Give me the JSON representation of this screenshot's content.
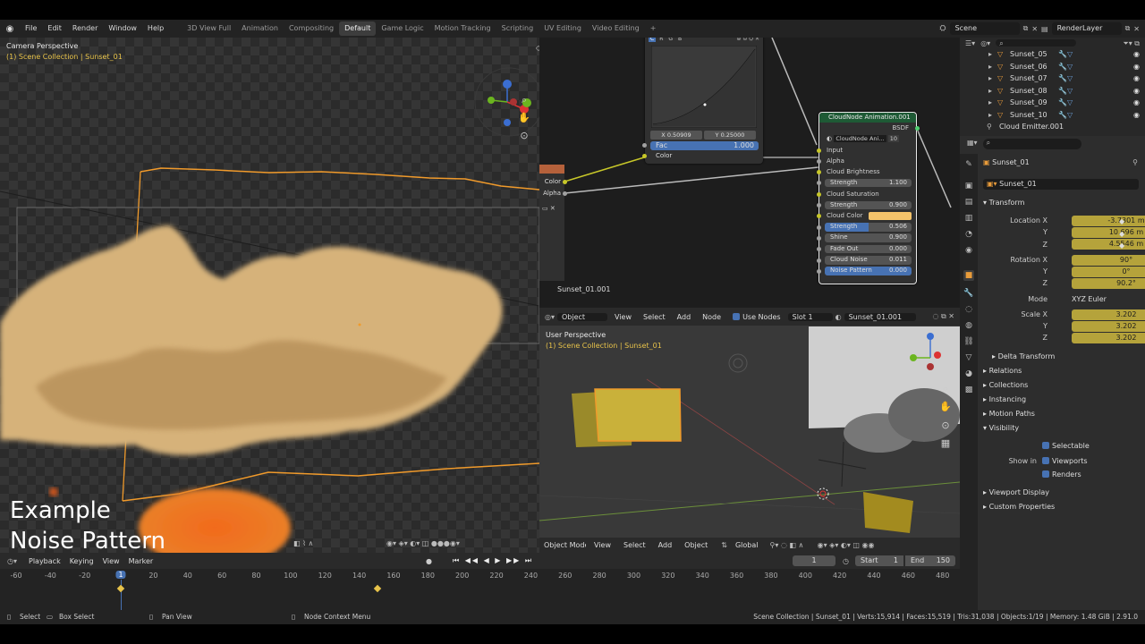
{
  "menu": {
    "file": "File",
    "edit": "Edit",
    "render": "Render",
    "window": "Window",
    "help": "Help"
  },
  "workspaces": [
    "3D View Full",
    "Animation",
    "Compositing",
    "Default",
    "Game Logic",
    "Motion Tracking",
    "Scripting",
    "UV Editing",
    "Video Editing"
  ],
  "active_workspace": "Default",
  "scene_name": "Scene",
  "render_layer": "RenderLayer",
  "camera_view": {
    "title": "Camera Perspective",
    "subtitle": "(1) Scene Collection | Sunset_01"
  },
  "caption": {
    "line1": "Example",
    "line2": "Noise Pattern"
  },
  "curve_node": {
    "tabs": [
      "C",
      "R",
      "G",
      "B"
    ],
    "x_readout": "X 0.50909",
    "y_readout": "Y 0.25000",
    "fac_label": "Fac",
    "fac_value": "1.000",
    "color_label": "Color"
  },
  "left_sockets": {
    "color": "Color",
    "alpha": "Alpha"
  },
  "cloud_node": {
    "title": "CloudNode Animation.001",
    "output": "BSDF",
    "group_field": "CloudNode Ani...",
    "users": "10",
    "rows": {
      "input": "Input",
      "alpha": "Alpha",
      "cloud_brightness": "Cloud Brightness",
      "strength1_label": "Strength",
      "strength1_value": "1.100",
      "cloud_saturation": "Cloud Saturation",
      "strength2_label": "Strength",
      "strength2_value": "0.900",
      "cloud_color": "Cloud Color",
      "strength3_label": "Strength",
      "strength3_value": "0.506",
      "strength3_fraction": 0.506,
      "shine_label": "Shine",
      "shine_value": "0.900",
      "fade_out_label": "Fade Out",
      "fade_out_value": "0.000",
      "cloud_noise_label": "Cloud Noise",
      "cloud_noise_value": "0.011",
      "noise_pattern_label": "Noise Pattern",
      "noise_pattern_value": "0.000"
    },
    "cloud_color_hex": "#f5c36b"
  },
  "node_editor_label": "Sunset_01.001",
  "node_header": {
    "mode": "Object",
    "view": "View",
    "select": "Select",
    "add": "Add",
    "node": "Node",
    "use_nodes": "Use Nodes",
    "slot": "Slot 1",
    "material": "Sunset_01.001"
  },
  "viewport3d": {
    "title": "User Perspective",
    "subtitle": "(1) Scene Collection | Sunset_01"
  },
  "v3_header": {
    "mode": "Object Mode",
    "view": "View",
    "select": "Select",
    "add": "Add",
    "object": "Object",
    "orientation": "Global"
  },
  "timeline": {
    "playback": "Playback",
    "keying": "Keying",
    "view": "View",
    "marker": "Marker",
    "current_frame": "1",
    "start_label": "Start",
    "start": "1",
    "end_label": "End",
    "end": "150",
    "ticks": [
      "-60",
      "-40",
      "-20",
      "1",
      "20",
      "40",
      "60",
      "80",
      "100",
      "120",
      "140",
      "160",
      "180",
      "200",
      "220",
      "240",
      "260",
      "280",
      "300",
      "320",
      "340",
      "360",
      "380",
      "400",
      "420",
      "440",
      "460",
      "480"
    ]
  },
  "outliner": {
    "items": [
      "Sunset_05",
      "Sunset_06",
      "Sunset_07",
      "Sunset_08",
      "Sunset_09",
      "Sunset_10",
      "Cloud Emitter.001"
    ]
  },
  "properties": {
    "object_name": "Sunset_01",
    "object_field": "Sunset_01",
    "transform_header": "Transform",
    "location_label": "Location X",
    "loc_x": "-3.7301 m",
    "loc_y": "10.696 m",
    "loc_z": "4.5546 m",
    "rotation_label": "Rotation X",
    "rot_x": "90°",
    "rot_y": "0°",
    "rot_z": "90.2°",
    "mode_label": "Mode",
    "mode_value": "XYZ Euler",
    "scale_label": "Scale X",
    "scale_x": "3.202",
    "scale_y": "3.202",
    "scale_z": "3.202",
    "y": "Y",
    "z": "Z",
    "delta_transform": "Delta Transform",
    "relations": "Relations",
    "collections": "Collections",
    "instancing": "Instancing",
    "motion_paths": "Motion Paths",
    "visibility": "Visibility",
    "selectable": "Selectable",
    "show_in": "Show in",
    "viewports": "Viewports",
    "renders": "Renders",
    "viewport_display": "Viewport Display",
    "custom_properties": "Custom Properties"
  },
  "status": {
    "select": "Select",
    "box_select": "Box Select",
    "pan_view": "Pan View",
    "node_context": "Node Context Menu",
    "stats": "Scene Collection | Sunset_01 | Verts:15,914 | Faces:15,519 | Tris:31,038 | Objects:1/19 | Memory: 1.48 GiB | 2.91.0"
  },
  "colors": {
    "accent": "#4772b3",
    "selected_orange": "#f09a2b",
    "anim_field": "#b5a33b",
    "cloud": "#d6b27a"
  }
}
